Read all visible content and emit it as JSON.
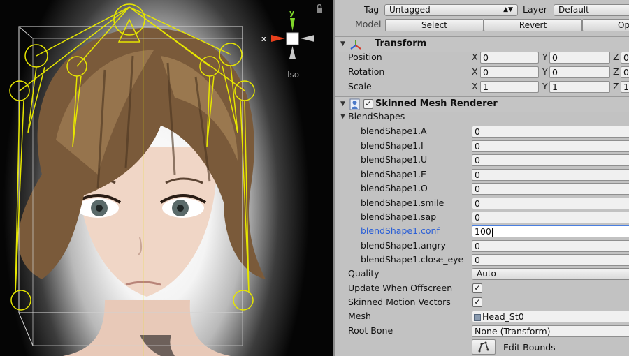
{
  "scene": {
    "view_mode": "Iso",
    "gizmo": {
      "y_label": "y",
      "x_label": "x"
    }
  },
  "object": {
    "tag_label": "Tag",
    "tag_value": "Untagged",
    "layer_label": "Layer",
    "layer_value": "Default",
    "model_label": "Model",
    "select_label": "Select",
    "revert_label": "Revert",
    "open_label": "Op"
  },
  "transform": {
    "title": "Transform",
    "rows": [
      {
        "label": "Position",
        "x": "0",
        "y": "0",
        "z": "0"
      },
      {
        "label": "Rotation",
        "x": "0",
        "y": "0",
        "z": "0"
      },
      {
        "label": "Scale",
        "x": "1",
        "y": "1",
        "z": "1"
      }
    ],
    "axis_x": "X",
    "axis_y": "Y",
    "axis_z": "Z"
  },
  "renderer": {
    "title": "Skinned Mesh Renderer",
    "enabled": true,
    "blendshapes_label": "BlendShapes",
    "blendshapes": [
      {
        "name": "blendShape1.A",
        "value": "0"
      },
      {
        "name": "blendShape1.I",
        "value": "0"
      },
      {
        "name": "blendShape1.U",
        "value": "0"
      },
      {
        "name": "blendShape1.E",
        "value": "0"
      },
      {
        "name": "blendShape1.O",
        "value": "0"
      },
      {
        "name": "blendShape1.smile",
        "value": "0"
      },
      {
        "name": "blendShape1.sap",
        "value": "0"
      },
      {
        "name": "blendShape1.conf",
        "value": "100"
      },
      {
        "name": "blendShape1.angry",
        "value": "0"
      },
      {
        "name": "blendShape1.close_eye",
        "value": "0"
      }
    ],
    "quality_label": "Quality",
    "quality_value": "Auto",
    "offscreen_label": "Update When Offscreen",
    "offscreen_checked": true,
    "motion_label": "Skinned Motion Vectors",
    "motion_checked": true,
    "mesh_label": "Mesh",
    "mesh_value": "Head_St0",
    "rootbone_label": "Root Bone",
    "rootbone_value": "None (Transform)",
    "edit_bounds_label": "Edit Bounds"
  },
  "colors": {
    "bone_yellow": "#e6e600",
    "focus_blue": "#2a5fd6",
    "gizmo_red": "#e8401c",
    "gizmo_green": "#7fd62a"
  },
  "icons": [
    "lock-icon",
    "transform-axes-icon",
    "skinned-mesh-icon",
    "edit-bounds-icon",
    "mesh-asset-icon"
  ]
}
